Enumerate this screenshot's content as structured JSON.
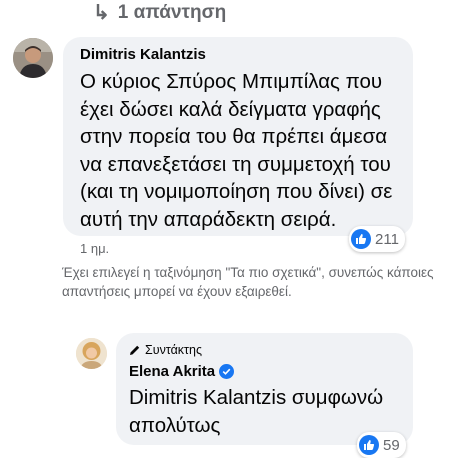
{
  "replies": {
    "label": "1 απάντηση"
  },
  "comment": {
    "author": "Dimitris Kalantzis",
    "text": "Ο κύριος Σπύρος Μπιμπίλας που έχει δώσει καλά δείγματα γραφής στην πορεία του θα πρέπει άμεσα να επανεξετάσει τη συμμετοχή του (και τη νομιμοποίηση που δίνει) σε αυτή την απαράδεκτη σειρά.",
    "reaction_count": "211",
    "time": "1 ημ."
  },
  "sort_notice": "Έχει επιλεγεί η ταξινόμηση \"Τα πιο σχετικά\", συνεπώς κάποιες απαντήσεις μπορεί να έχουν εξαιρεθεί.",
  "reply": {
    "badge": "Συντάκτης",
    "author": "Elena Akrita",
    "text": "Dimitris Kalantzis συμφωνώ απολύτως",
    "reaction_count": "59"
  },
  "colors": {
    "accent": "#1877f2",
    "bubble": "#f0f2f5",
    "muted_text": "#65676b"
  }
}
